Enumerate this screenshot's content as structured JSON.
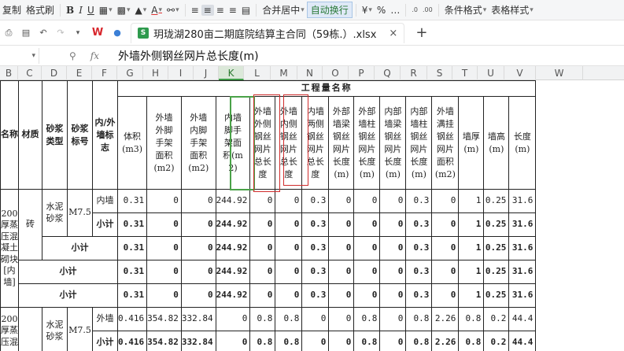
{
  "toolbar": {
    "format_painter_prefix": "复制",
    "format_painter": "格式刷",
    "bold": "B",
    "italic": "I",
    "underline": "U",
    "merge_center": "合并居中",
    "auto_wrap": "自动换行",
    "percent": "%",
    "conditional_format": "条件格式",
    "table_style": "表格样式"
  },
  "tab": {
    "wps_label": "W",
    "file_name": "玥珑湖280亩二期庭院结算主合同（59栋.）.xlsx",
    "close": "×",
    "new_tab": "+"
  },
  "formula_bar": {
    "fx": "fx",
    "value": "外墙外侧钢丝网片总长度(m)"
  },
  "columns": [
    "B",
    "C",
    "D",
    "E",
    "F",
    "G",
    "H",
    "I",
    "J",
    "K",
    "L",
    "M",
    "N",
    "O",
    "P",
    "Q",
    "R",
    "S",
    "T",
    "U",
    "V",
    "W"
  ],
  "selected_column": "K",
  "header": {
    "engineering_qty": "工程量名称",
    "name": "名称",
    "material": "材质",
    "mortar_type": "砂浆类型",
    "mortar_grade": "砂浆标号",
    "wall_flag": "内/外墙标志",
    "volume": "体积(m3)",
    "ext_scaffold": "外墙外脚手架面积(m2)",
    "ext_in_scaffold": "外墙内脚手架面积(m2)",
    "int_scaffold": "内墙脚手架面积(m2)",
    "ext_out_mesh": "外墙外侧钢丝网片总长度",
    "ext_in_mesh": "外墙内侧钢丝网片总长度",
    "int_both_mesh": "内墙两侧钢丝网片总长度",
    "ext_beam_mesh": "外部墙梁钢丝网片长度(m)",
    "ext_col_mesh": "外部墙柱钢丝网片长度(m)",
    "int_beam_mesh": "内部墙梁钢丝网片长度(m)",
    "int_col_mesh": "内部墙柱钢丝网片长度(m)",
    "ext_full_mesh": "外墙满挂钢丝网片面积(m2)",
    "wall_thickness": "墙厚(m)",
    "wall_height": "墙高(m)",
    "length": "长度(m)"
  },
  "left": {
    "block1_name": "200 厚蒸压混凝土砌块[内墙]",
    "material": "砖",
    "mortar_type": "水泥砂浆",
    "mortar_grade": "M7.5",
    "block2_name": "200 厚蒸压混",
    "subtotal": "小计"
  },
  "rows": [
    {
      "flag": "内墙",
      "vals": [
        "0.31",
        "0",
        "0",
        "244.92",
        "0",
        "0",
        "0.3",
        "0",
        "0",
        "0",
        "0.3",
        "0",
        "1",
        "0.25",
        "31.6"
      ],
      "bold": false
    },
    {
      "flag": "小计",
      "vals": [
        "0.31",
        "0",
        "0",
        "244.92",
        "0",
        "0",
        "0.3",
        "0",
        "0",
        "0",
        "0.3",
        "0",
        "1",
        "0.25",
        "31.6"
      ],
      "bold": true
    },
    {
      "flag": "小计",
      "vals": [
        "0.31",
        "0",
        "0",
        "244.92",
        "0",
        "0",
        "0.3",
        "0",
        "0",
        "0",
        "0.3",
        "0",
        "1",
        "0.25",
        "31.6"
      ],
      "bold": true
    },
    {
      "flag": "小计",
      "vals": [
        "0.31",
        "0",
        "0",
        "244.92",
        "0",
        "0",
        "0.3",
        "0",
        "0",
        "0",
        "0.3",
        "0",
        "1",
        "0.25",
        "31.6"
      ],
      "bold": true
    },
    {
      "flag": "小计",
      "vals": [
        "0.31",
        "0",
        "0",
        "244.92",
        "0",
        "0",
        "0.3",
        "0",
        "0",
        "0",
        "0.3",
        "0",
        "1",
        "0.25",
        "31.6"
      ],
      "bold": true
    },
    {
      "flag": "外墙",
      "vals": [
        "0.416",
        "354.82",
        "332.84",
        "0",
        "0.8",
        "0.8",
        "0",
        "0",
        "0.8",
        "0",
        "0.8",
        "2.26",
        "0.8",
        "0.2",
        "44.4"
      ],
      "bold": false
    },
    {
      "flag": "小计",
      "vals": [
        "0.416",
        "354.82",
        "332.84",
        "0",
        "0.8",
        "0.8",
        "0",
        "0",
        "0.8",
        "0",
        "0.8",
        "2.26",
        "0.8",
        "0.2",
        "44.4"
      ],
      "bold": true
    }
  ]
}
